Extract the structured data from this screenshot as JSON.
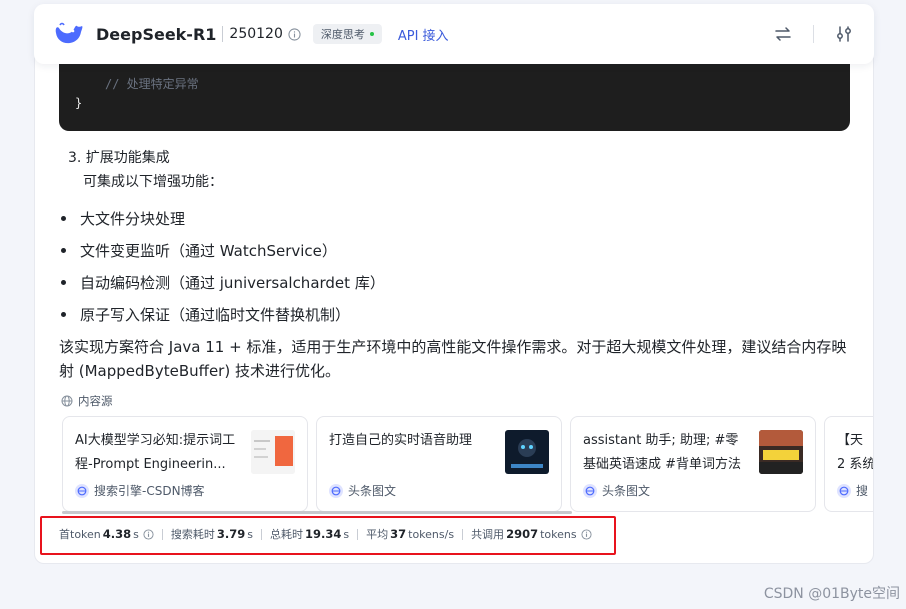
{
  "header": {
    "model_name": "DeepSeek-R1",
    "version": "250120",
    "think_badge": "深度思考",
    "api_link": "API 接入"
  },
  "code": {
    "comment_line": "// 处理特定异常",
    "closing_brace": "}"
  },
  "content": {
    "step_title": "3. 扩展功能集成",
    "step_desc": "可集成以下增强功能：",
    "bullets": [
      "大文件分块处理",
      "文件变更监听（通过 WatchService）",
      "自动编码检测（通过 juniversalchardet 库）",
      "原子写入保证（通过临时文件替换机制）"
    ],
    "summary": "该实现方案符合 Java 11 + 标准，适用于生产环境中的高性能文件操作需求。对于超大规模文件处理，建议结合内存映射 (MappedByteBuffer) 技术进行优化。"
  },
  "sources": {
    "label": "内容源",
    "cards": [
      {
        "title": "AI大模型学习必知:提示词工程-Prompt Engineerin...",
        "source": "搜索引擎-CSDN博客"
      },
      {
        "title": "打造自己的实时语音助理",
        "source": "头条图文"
      },
      {
        "title": "assistant 助手; 助理; #零基础英语速成 #背单词方法",
        "source": "头条图文"
      },
      {
        "title": "【天",
        "title_line2": "2 系统",
        "source": "搜"
      }
    ]
  },
  "stats": {
    "first_token_label": "首token",
    "first_token_value": "4.38",
    "search_label": "搜索耗时",
    "search_value": "3.79",
    "total_label": "总耗时",
    "total_value": "19.34",
    "avg_label": "平均",
    "avg_value": "37",
    "avg_unit": "tokens/s",
    "sum_label": "共调用",
    "sum_value": "2907",
    "sum_unit": "tokens",
    "sec_unit": "s"
  },
  "watermark": "CSDN @01Byte空间",
  "colors": {
    "accent": "#3b5bdb",
    "highlight": "#e8131d",
    "code_bg": "#1e1e1e",
    "status_green": "#27c346"
  }
}
